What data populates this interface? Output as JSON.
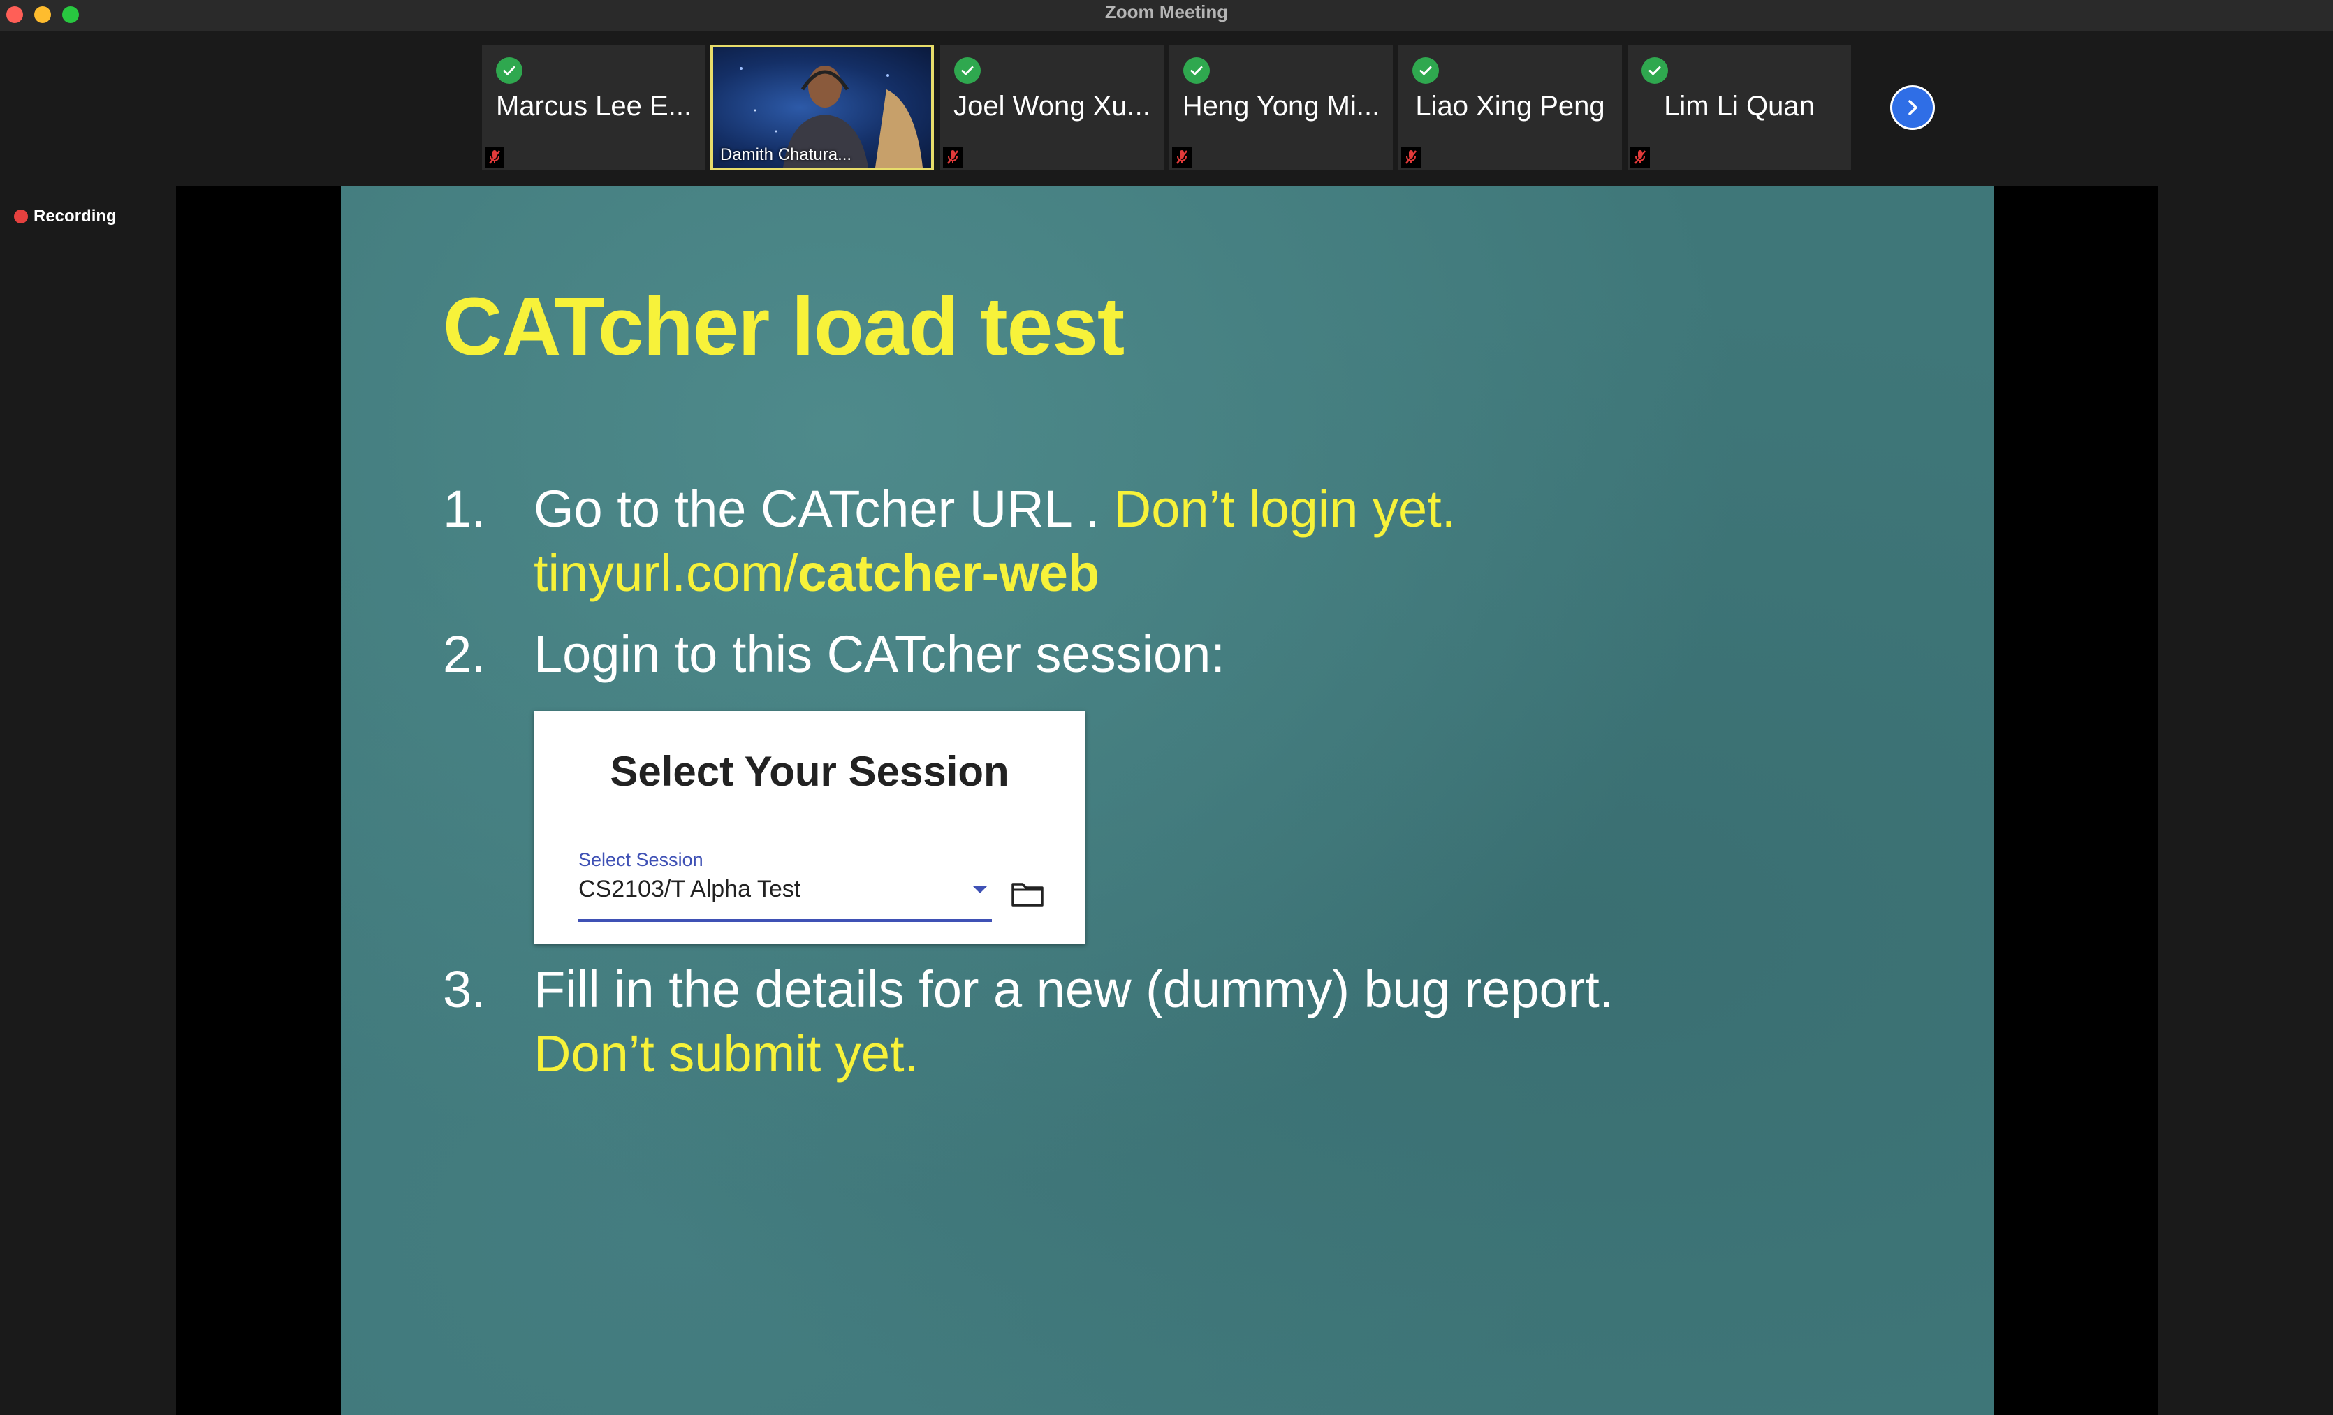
{
  "window": {
    "title": "Zoom Meeting"
  },
  "participants": [
    {
      "name": "Marcus Lee E...",
      "verified": true,
      "muted": true
    },
    {
      "name": "Damith Chatura...",
      "video": true
    },
    {
      "name": "Joel Wong Xu...",
      "verified": true,
      "muted": true
    },
    {
      "name": "Heng Yong Mi...",
      "verified": true,
      "muted": true
    },
    {
      "name": "Liao Xing Peng",
      "verified": true,
      "muted": true
    },
    {
      "name": "Lim Li Quan",
      "verified": true,
      "muted": true
    }
  ],
  "recording": {
    "label": "Recording",
    "color": "#e5413f"
  },
  "slide": {
    "title": "CATcher load test",
    "items": [
      {
        "number": "1.",
        "text": "Go to the CATcher URL . ",
        "highlight": "Don’t login yet.",
        "link_prefix": "tinyurl.com/",
        "link_bold": "catcher-web"
      },
      {
        "number": "2.",
        "text": "Login to this CATcher session:"
      },
      {
        "number": "3.",
        "text": "Fill in the details for a new (dummy) bug report.",
        "highlight": "Don’t submit yet."
      }
    ],
    "session_card": {
      "title": "Select Your Session",
      "field_label": "Select Session",
      "field_value": "CS2103/T Alpha Test",
      "icon": "folder-icon"
    },
    "colors": {
      "title": "#f7f23a",
      "highlight": "#f7f23a",
      "text": "#ffffff",
      "background": "#3f7779",
      "accent": "#3f51b5"
    }
  }
}
